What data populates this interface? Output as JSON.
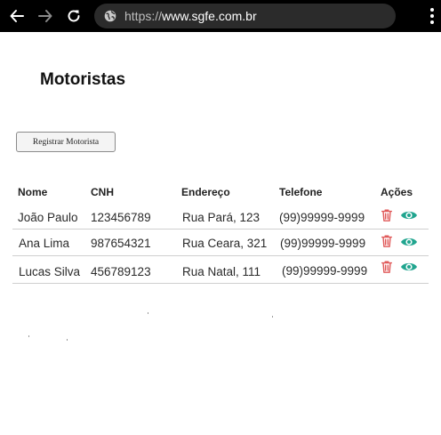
{
  "browser": {
    "url_scheme": "https://",
    "url_host": "www.sgfe.com.br"
  },
  "page": {
    "title": "Motoristas",
    "register_button": "Registrar Motorista"
  },
  "table": {
    "headers": [
      "Nome",
      "CNH",
      "Endereço",
      "Telefone",
      "Ações"
    ],
    "rows": [
      {
        "nome": "João Paulo",
        "cnh": "123456789",
        "endereco": "Rua Pará, 123",
        "telefone": "(99)99999-9999"
      },
      {
        "nome": "Ana Lima",
        "cnh": "987654321",
        "endereco": "Rua Ceara, 321",
        "telefone": "(99)99999-9999"
      },
      {
        "nome": "Lucas Silva",
        "cnh": "456789123",
        "endereco": "Rua Natal, 111",
        "telefone": "(99)99999-9999"
      }
    ],
    "action_icons": [
      "trash-icon",
      "eye-icon"
    ]
  },
  "colors": {
    "delete": "#e05a5a",
    "view": "#21a58f",
    "toolbar": "#000000"
  }
}
